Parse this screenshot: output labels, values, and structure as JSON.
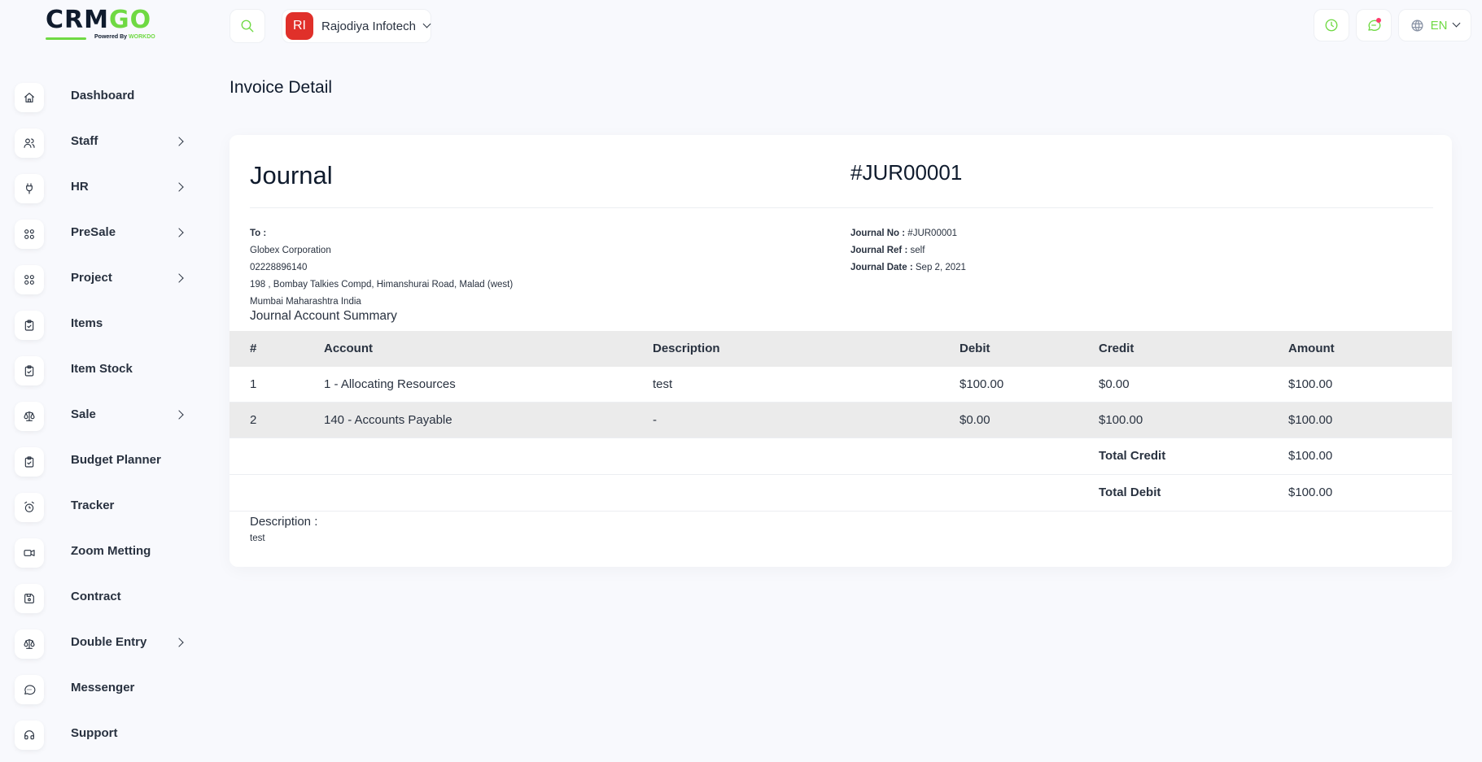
{
  "brand": {
    "name_a": "CRM",
    "name_b": "GO",
    "powered": "Powered By",
    "powered_brand": "WORKDO"
  },
  "sidebar": {
    "items": [
      {
        "label": "Dashboard",
        "icon": "home-icon",
        "has_children": false
      },
      {
        "label": "Staff",
        "icon": "users-icon",
        "has_children": true
      },
      {
        "label": "HR",
        "icon": "plug-icon",
        "has_children": true
      },
      {
        "label": "PreSale",
        "icon": "grid-icon",
        "has_children": true
      },
      {
        "label": "Project",
        "icon": "grid-icon",
        "has_children": true
      },
      {
        "label": "Items",
        "icon": "clipboard-check-icon",
        "has_children": false
      },
      {
        "label": "Item Stock",
        "icon": "clipboard-check-icon",
        "has_children": false
      },
      {
        "label": "Sale",
        "icon": "scale-icon",
        "has_children": true
      },
      {
        "label": "Budget Planner",
        "icon": "clipboard-check-icon",
        "has_children": false
      },
      {
        "label": "Tracker",
        "icon": "alarm-icon",
        "has_children": false
      },
      {
        "label": "Zoom Metting",
        "icon": "video-icon",
        "has_children": false
      },
      {
        "label": "Contract",
        "icon": "device-floppy-icon",
        "has_children": false
      },
      {
        "label": "Double Entry",
        "icon": "scale-icon",
        "has_children": true
      },
      {
        "label": "Messenger",
        "icon": "message-icon",
        "has_children": false
      },
      {
        "label": "Support",
        "icon": "headset-icon",
        "has_children": false
      }
    ]
  },
  "header": {
    "company_initials": "RI",
    "company_name": "Rajodiya Infotech",
    "language": "EN",
    "accent": "#6fd943",
    "avatar_color": "#e0302a"
  },
  "page": {
    "title": "Invoice Detail"
  },
  "invoice": {
    "type_title": "Journal",
    "number": "#JUR00001",
    "to_label": "To :",
    "to_lines": [
      "Globex Corporation",
      "02228896140",
      "198 , Bombay Talkies Compd, Himanshurai Road, Malad (west)",
      "Mumbai Maharashtra India"
    ],
    "meta": [
      {
        "label": "Journal No :",
        "value": "#JUR00001"
      },
      {
        "label": "Journal Ref :",
        "value": "self"
      },
      {
        "label": "Journal Date :",
        "value": "Sep 2, 2021"
      }
    ],
    "summary_title": "Journal Account Summary",
    "columns": [
      "#",
      "Account",
      "Description",
      "Debit",
      "Credit",
      "Amount"
    ],
    "rows": [
      {
        "num": "1",
        "account": "1 - Allocating Resources",
        "description": "test",
        "debit": "$100.00",
        "credit": "$0.00",
        "amount": "$100.00"
      },
      {
        "num": "2",
        "account": "140 - Accounts Payable",
        "description": "-",
        "debit": "$0.00",
        "credit": "$100.00",
        "amount": "$100.00"
      }
    ],
    "totals": [
      {
        "label": "Total Credit",
        "value": "$100.00"
      },
      {
        "label": "Total Debit",
        "value": "$100.00"
      }
    ],
    "description_label": "Description :",
    "description_text": "test"
  }
}
